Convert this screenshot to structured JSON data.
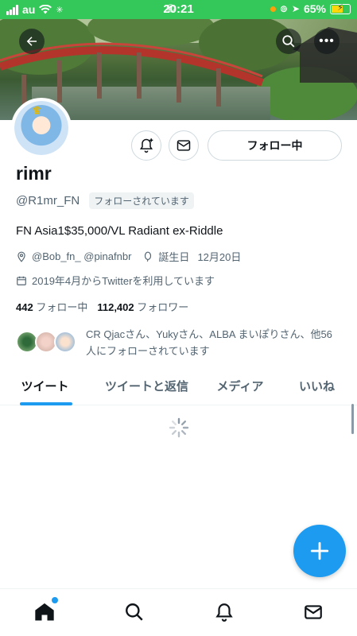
{
  "status_bar": {
    "carrier": "au",
    "time": "20:21",
    "battery": "65%",
    "battery_level": 0.65,
    "accent": "#34c759"
  },
  "header": {
    "back_icon": "arrow-left-icon",
    "search_icon": "search-icon",
    "more_icon": "more-horizontal-icon"
  },
  "profile": {
    "name": "rimr",
    "handle": "@R1mr_FN",
    "follows_you_badge": "フォローされています",
    "bio": "FN Asia1$35,000/VL Radiant ex-Riddle",
    "location": "@Bob_fn_ @pinafnbr",
    "birthday_label": "誕生日",
    "birthday": "12月20日",
    "joined": "2019年4月からTwitterを利用しています",
    "following_count": "442",
    "following_label": "フォロー中",
    "followers_count": "112,402",
    "followers_label": "フォロワー",
    "followed_by_text": "CR Qjacさん、Yukyさん、ALBA まいぽりさん、他56人にフォローされています"
  },
  "actions": {
    "notify_icon": "bell-plus-icon",
    "message_icon": "mail-icon",
    "follow_button": "フォロー中"
  },
  "tabs": [
    {
      "label": "ツイート",
      "active": true
    },
    {
      "label": "ツイートと返信",
      "active": false
    },
    {
      "label": "メディア",
      "active": false
    },
    {
      "label": "いいね",
      "active": false
    }
  ],
  "fab": {
    "icon": "plus-icon"
  },
  "bottom_nav": [
    {
      "icon": "home-icon",
      "has_dot": true
    },
    {
      "icon": "search-icon",
      "has_dot": false
    },
    {
      "icon": "bell-icon",
      "has_dot": false
    },
    {
      "icon": "mail-icon",
      "has_dot": false
    }
  ],
  "colors": {
    "accent": "#1d9bf0",
    "text_primary": "#0f1419",
    "text_secondary": "#536471"
  }
}
